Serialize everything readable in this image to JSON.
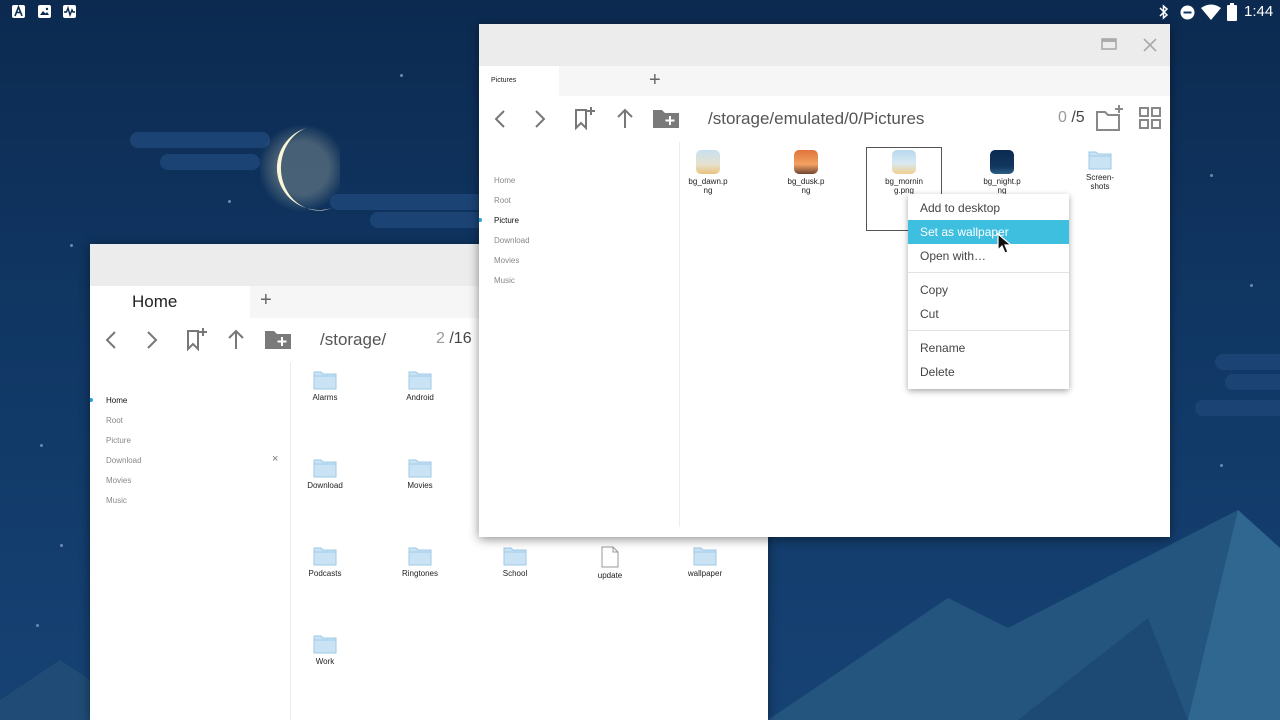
{
  "statusbar": {
    "time": "1:44",
    "left_icons": [
      "app-a-icon",
      "image-icon",
      "activity-icon"
    ],
    "right_icons": [
      "bluetooth-icon",
      "do-not-disturb-icon",
      "wifi-icon",
      "battery-icon"
    ]
  },
  "front_window": {
    "tab_label": "Pictures",
    "add_tab": "+",
    "path": "/storage/emulated/0/Pictures",
    "selected_count": "0",
    "total_count": "/5",
    "sidebar": [
      "Home",
      "Root",
      "Picture",
      "Download",
      "Movies",
      "Music"
    ],
    "active_sidebar": "Picture",
    "files": [
      {
        "label": "bg_dawn.p\nng",
        "kind": "dawn"
      },
      {
        "label": "bg_dusk.p\nng",
        "kind": "dusk"
      },
      {
        "label": "bg_mornin\ng.png",
        "kind": "morning"
      },
      {
        "label": "bg_night.p\nng",
        "kind": "night"
      },
      {
        "label": "Screen-\nshots",
        "kind": "folder"
      }
    ]
  },
  "back_window": {
    "tab_label": "Home",
    "add_tab": "+",
    "path": "/storage/",
    "selected_count": "2",
    "total_count": "/16",
    "sidebar": [
      "Home",
      "Root",
      "Picture",
      "Download",
      "Movies",
      "Music"
    ],
    "active_sidebar": "Home",
    "files": [
      {
        "label": "Alarms",
        "kind": "folder"
      },
      {
        "label": "Android",
        "kind": "folder"
      },
      {
        "label": "Download",
        "kind": "folder"
      },
      {
        "label": "Movies",
        "kind": "folder"
      },
      {
        "label": "Podcasts",
        "kind": "folder"
      },
      {
        "label": "Ringtones",
        "kind": "folder"
      },
      {
        "label": "School",
        "kind": "folder"
      },
      {
        "label": "update",
        "kind": "file"
      },
      {
        "label": "wallpaper",
        "kind": "folder"
      },
      {
        "label": "Work",
        "kind": "folder"
      }
    ]
  },
  "context_menu": {
    "items": [
      "Add to desktop",
      "Set as wallpaper",
      "Open with…",
      "Copy",
      "Cut",
      "Rename",
      "Delete"
    ],
    "highlighted": "Set as wallpaper"
  },
  "colors": {
    "accent": "#3ebfe0",
    "folder": "#c9e3f5",
    "folder_edge": "#9ec8e6",
    "mountain": "#2c5f86"
  }
}
